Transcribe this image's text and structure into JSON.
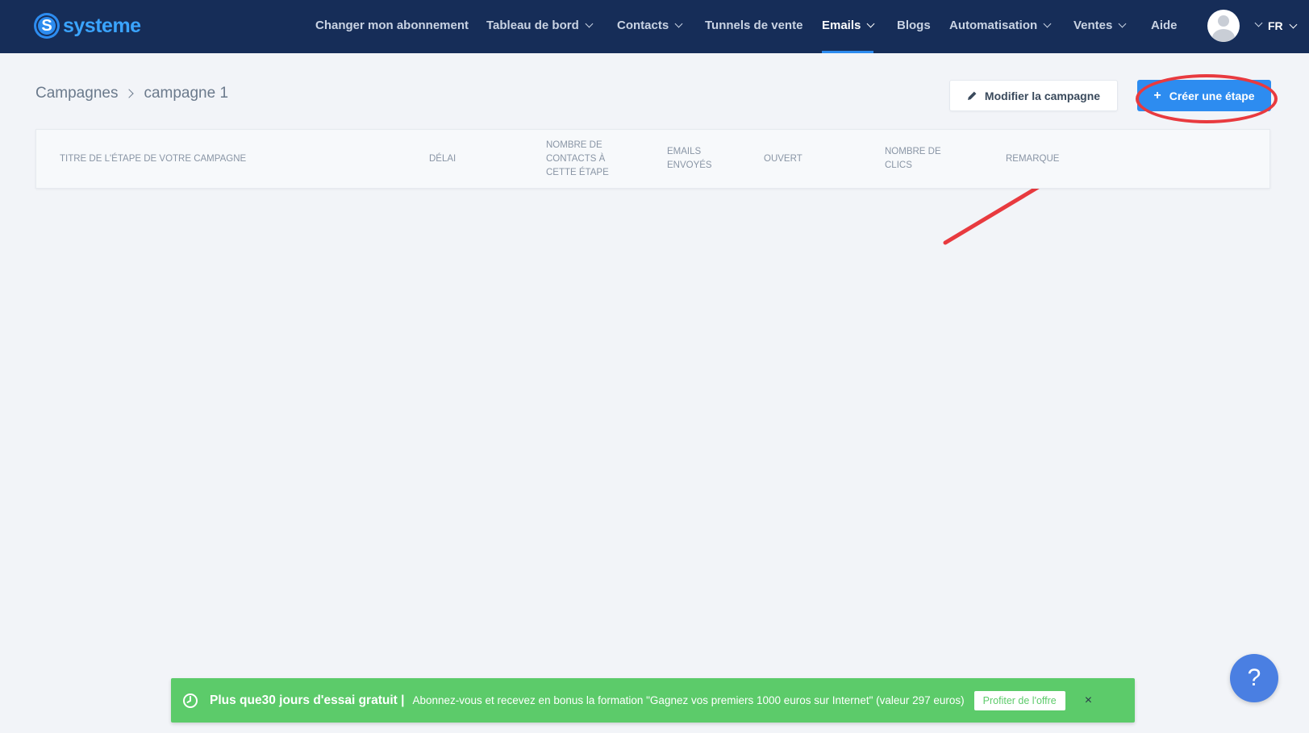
{
  "brand": {
    "name": "systeme",
    "logo_letter": "S",
    "color": "#3aa4ff"
  },
  "nav": {
    "items": [
      {
        "label": "Changer mon abonnement",
        "dropdown": false,
        "active": false
      },
      {
        "label": "Tableau de bord",
        "dropdown": true,
        "active": false
      },
      {
        "label": "Contacts",
        "dropdown": true,
        "active": false
      },
      {
        "label": "Tunnels de vente",
        "dropdown": false,
        "active": false
      },
      {
        "label": "Emails",
        "dropdown": true,
        "active": true
      },
      {
        "label": "Blogs",
        "dropdown": false,
        "active": false
      },
      {
        "label": "Automatisation",
        "dropdown": true,
        "active": false
      },
      {
        "label": "Ventes",
        "dropdown": true,
        "active": false
      },
      {
        "label": "Aide",
        "dropdown": false,
        "active": false
      }
    ],
    "language": "FR",
    "background": "#162d58"
  },
  "breadcrumb": {
    "parent": "Campagnes",
    "current": "campagne 1"
  },
  "actions": {
    "edit_label": "Modifier la campagne",
    "create_label": "Créer une étape",
    "create_icon": "+",
    "accent": "#2d8cf0"
  },
  "table": {
    "columns": [
      "TITRE DE L'ÉTAPE DE VOTRE CAMPAGNE",
      "DÉLAI",
      "NOMBRE DE CONTACTS À CETTE ÉTAPE",
      "EMAILS ENVOYÉS",
      "OUVERT",
      "NOMBRE DE CLICS",
      "REMARQUE"
    ],
    "rows": []
  },
  "promo": {
    "title": "Plus que30 jours d'essai gratuit |",
    "text": "Abonnez-vous et recevez en bonus la formation \"Gagnez vos premiers 1000 euros sur Internet\" (valeur 297 euros)",
    "cta": "Profiter de l'offre",
    "close": "×",
    "color": "#5ccb6a"
  },
  "help": {
    "label": "?"
  },
  "annotation": {
    "color": "#e83a3f"
  }
}
